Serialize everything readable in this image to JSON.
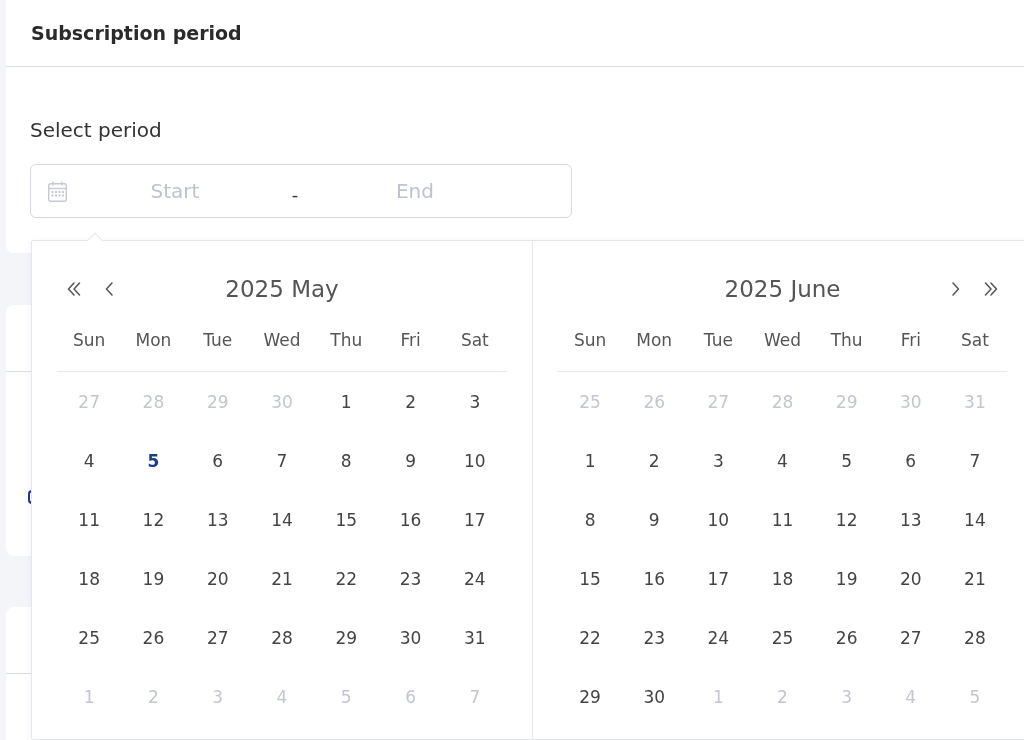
{
  "section": {
    "title": "Subscription period"
  },
  "period_field": {
    "label": "Select period",
    "start_placeholder": "Start",
    "separator": "-",
    "end_placeholder": "End"
  },
  "calendar": {
    "months": [
      {
        "title": "2025 May",
        "weekdays": [
          "Sun",
          "Mon",
          "Tue",
          "Wed",
          "Thu",
          "Fri",
          "Sat"
        ],
        "weeks": [
          [
            {
              "day": "27",
              "kind": "outside"
            },
            {
              "day": "28",
              "kind": "outside"
            },
            {
              "day": "29",
              "kind": "outside"
            },
            {
              "day": "30",
              "kind": "outside"
            },
            {
              "day": "1",
              "kind": "inside"
            },
            {
              "day": "2",
              "kind": "inside"
            },
            {
              "day": "3",
              "kind": "inside"
            }
          ],
          [
            {
              "day": "4",
              "kind": "inside"
            },
            {
              "day": "5",
              "kind": "today"
            },
            {
              "day": "6",
              "kind": "inside"
            },
            {
              "day": "7",
              "kind": "inside"
            },
            {
              "day": "8",
              "kind": "inside"
            },
            {
              "day": "9",
              "kind": "inside"
            },
            {
              "day": "10",
              "kind": "inside"
            }
          ],
          [
            {
              "day": "11",
              "kind": "inside"
            },
            {
              "day": "12",
              "kind": "inside"
            },
            {
              "day": "13",
              "kind": "inside"
            },
            {
              "day": "14",
              "kind": "inside"
            },
            {
              "day": "15",
              "kind": "inside"
            },
            {
              "day": "16",
              "kind": "inside"
            },
            {
              "day": "17",
              "kind": "inside"
            }
          ],
          [
            {
              "day": "18",
              "kind": "inside"
            },
            {
              "day": "19",
              "kind": "inside"
            },
            {
              "day": "20",
              "kind": "inside"
            },
            {
              "day": "21",
              "kind": "inside"
            },
            {
              "day": "22",
              "kind": "inside"
            },
            {
              "day": "23",
              "kind": "inside"
            },
            {
              "day": "24",
              "kind": "inside"
            }
          ],
          [
            {
              "day": "25",
              "kind": "inside"
            },
            {
              "day": "26",
              "kind": "inside"
            },
            {
              "day": "27",
              "kind": "inside"
            },
            {
              "day": "28",
              "kind": "inside"
            },
            {
              "day": "29",
              "kind": "inside"
            },
            {
              "day": "30",
              "kind": "inside"
            },
            {
              "day": "31",
              "kind": "inside"
            }
          ],
          [
            {
              "day": "1",
              "kind": "outside"
            },
            {
              "day": "2",
              "kind": "outside"
            },
            {
              "day": "3",
              "kind": "outside"
            },
            {
              "day": "4",
              "kind": "outside"
            },
            {
              "day": "5",
              "kind": "outside"
            },
            {
              "day": "6",
              "kind": "outside"
            },
            {
              "day": "7",
              "kind": "outside"
            }
          ]
        ]
      },
      {
        "title": "2025 June",
        "weekdays": [
          "Sun",
          "Mon",
          "Tue",
          "Wed",
          "Thu",
          "Fri",
          "Sat"
        ],
        "weeks": [
          [
            {
              "day": "25",
              "kind": "outside"
            },
            {
              "day": "26",
              "kind": "outside"
            },
            {
              "day": "27",
              "kind": "outside"
            },
            {
              "day": "28",
              "kind": "outside"
            },
            {
              "day": "29",
              "kind": "outside"
            },
            {
              "day": "30",
              "kind": "outside"
            },
            {
              "day": "31",
              "kind": "outside"
            }
          ],
          [
            {
              "day": "1",
              "kind": "inside"
            },
            {
              "day": "2",
              "kind": "inside"
            },
            {
              "day": "3",
              "kind": "inside"
            },
            {
              "day": "4",
              "kind": "inside"
            },
            {
              "day": "5",
              "kind": "inside"
            },
            {
              "day": "6",
              "kind": "inside"
            },
            {
              "day": "7",
              "kind": "inside"
            }
          ],
          [
            {
              "day": "8",
              "kind": "inside"
            },
            {
              "day": "9",
              "kind": "inside"
            },
            {
              "day": "10",
              "kind": "inside"
            },
            {
              "day": "11",
              "kind": "inside"
            },
            {
              "day": "12",
              "kind": "inside"
            },
            {
              "day": "13",
              "kind": "inside"
            },
            {
              "day": "14",
              "kind": "inside"
            }
          ],
          [
            {
              "day": "15",
              "kind": "inside"
            },
            {
              "day": "16",
              "kind": "inside"
            },
            {
              "day": "17",
              "kind": "inside"
            },
            {
              "day": "18",
              "kind": "inside"
            },
            {
              "day": "19",
              "kind": "inside"
            },
            {
              "day": "20",
              "kind": "inside"
            },
            {
              "day": "21",
              "kind": "inside"
            }
          ],
          [
            {
              "day": "22",
              "kind": "inside"
            },
            {
              "day": "23",
              "kind": "inside"
            },
            {
              "day": "24",
              "kind": "inside"
            },
            {
              "day": "25",
              "kind": "inside"
            },
            {
              "day": "26",
              "kind": "inside"
            },
            {
              "day": "27",
              "kind": "inside"
            },
            {
              "day": "28",
              "kind": "inside"
            }
          ],
          [
            {
              "day": "29",
              "kind": "inside"
            },
            {
              "day": "30",
              "kind": "inside"
            },
            {
              "day": "1",
              "kind": "outside"
            },
            {
              "day": "2",
              "kind": "outside"
            },
            {
              "day": "3",
              "kind": "outside"
            },
            {
              "day": "4",
              "kind": "outside"
            },
            {
              "day": "5",
              "kind": "outside"
            }
          ]
        ]
      }
    ]
  }
}
